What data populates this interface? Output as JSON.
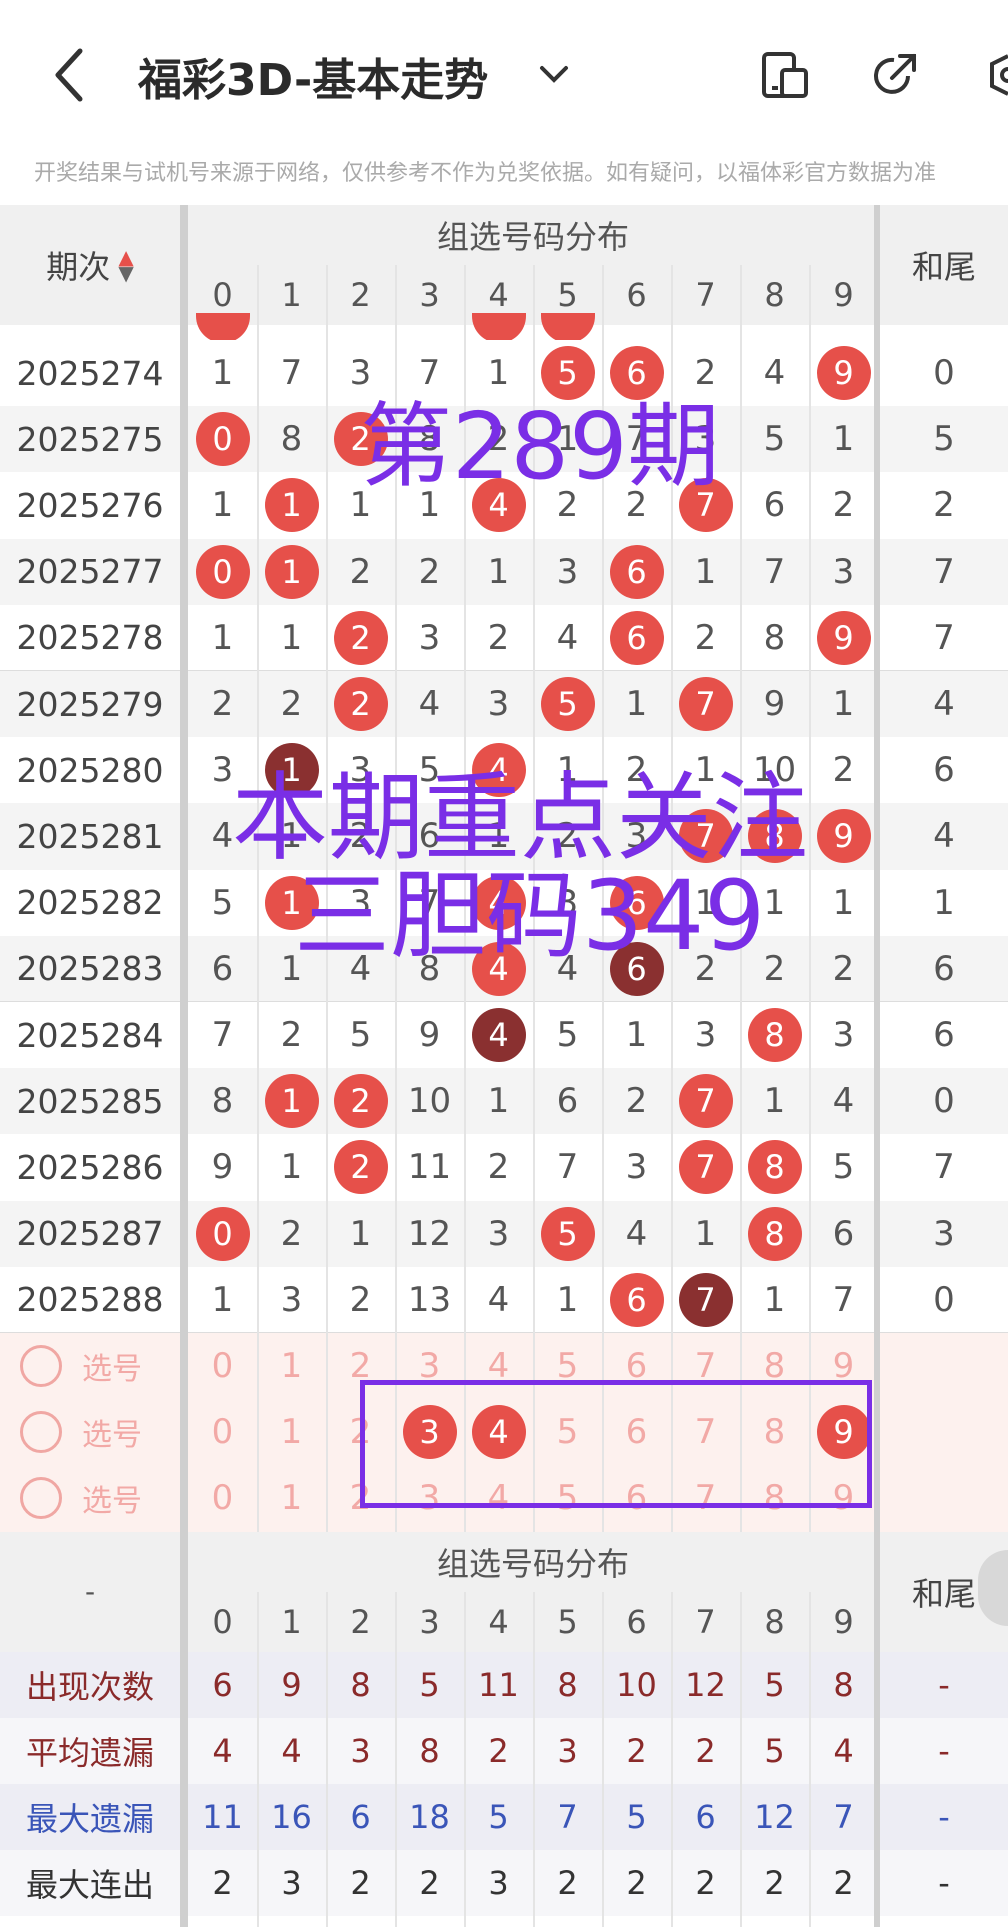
{
  "header": {
    "title": "福彩3D-基本走势",
    "notice": "开奖结果与试机号来源于网络，仅供参考不作为兑奖依据。如有疑问，以福体彩官方数据为准"
  },
  "table": {
    "col_period": "期次",
    "group_title": "组选号码分布",
    "digits": [
      "0",
      "1",
      "2",
      "3",
      "4",
      "5",
      "6",
      "7",
      "8",
      "9"
    ],
    "col_sum_tail": "和尾",
    "rows": [
      {
        "period": "2025274",
        "cells": [
          "1",
          "7",
          "3",
          "7",
          "1",
          "5",
          "6",
          "2",
          "4",
          "9"
        ],
        "hits": [
          5,
          6,
          9
        ],
        "dark": [],
        "tail": "0"
      },
      {
        "period": "2025275",
        "cells": [
          "0",
          "8",
          "2",
          "8",
          "2",
          "1",
          "7",
          "3",
          "5",
          "1"
        ],
        "hits": [
          0,
          2
        ],
        "dark": [],
        "tail": "5"
      },
      {
        "period": "2025276",
        "cells": [
          "1",
          "1",
          "1",
          "1",
          "4",
          "2",
          "2",
          "7",
          "6",
          "2"
        ],
        "hits": [
          1,
          4,
          7
        ],
        "dark": [],
        "tail": "2"
      },
      {
        "period": "2025277",
        "cells": [
          "0",
          "1",
          "2",
          "2",
          "1",
          "3",
          "6",
          "1",
          "7",
          "3"
        ],
        "hits": [
          0,
          1,
          6
        ],
        "dark": [],
        "tail": "7"
      },
      {
        "period": "2025278",
        "cells": [
          "1",
          "1",
          "2",
          "3",
          "2",
          "4",
          "6",
          "2",
          "8",
          "9"
        ],
        "hits": [
          2,
          6,
          9
        ],
        "dark": [],
        "tail": "7"
      },
      {
        "period": "2025279",
        "cells": [
          "2",
          "2",
          "2",
          "4",
          "3",
          "5",
          "1",
          "7",
          "9",
          "1"
        ],
        "hits": [
          2,
          5,
          7
        ],
        "dark": [],
        "tail": "4"
      },
      {
        "period": "2025280",
        "cells": [
          "3",
          "1",
          "3",
          "5",
          "4",
          "1",
          "2",
          "1",
          "10",
          "2"
        ],
        "hits": [
          4
        ],
        "dark": [
          1
        ],
        "tail": "6"
      },
      {
        "period": "2025281",
        "cells": [
          "4",
          "1",
          "2",
          "6",
          "1",
          "2",
          "3",
          "7",
          "8",
          "9"
        ],
        "hits": [
          7,
          8,
          9
        ],
        "dark": [],
        "tail": "4"
      },
      {
        "period": "2025282",
        "cells": [
          "5",
          "1",
          "3",
          "7",
          "4",
          "3",
          "6",
          "1",
          "1",
          "1"
        ],
        "hits": [
          1,
          4,
          6
        ],
        "dark": [],
        "tail": "1"
      },
      {
        "period": "2025283",
        "cells": [
          "6",
          "1",
          "4",
          "8",
          "4",
          "4",
          "6",
          "2",
          "2",
          "2"
        ],
        "hits": [
          4
        ],
        "dark": [
          6
        ],
        "tail": "6"
      },
      {
        "period": "2025284",
        "cells": [
          "7",
          "2",
          "5",
          "9",
          "4",
          "5",
          "1",
          "3",
          "8",
          "3"
        ],
        "hits": [
          8
        ],
        "dark": [
          4
        ],
        "tail": "6"
      },
      {
        "period": "2025285",
        "cells": [
          "8",
          "1",
          "2",
          "10",
          "1",
          "6",
          "2",
          "7",
          "1",
          "4"
        ],
        "hits": [
          1,
          2,
          7
        ],
        "dark": [],
        "tail": "0"
      },
      {
        "period": "2025286",
        "cells": [
          "9",
          "1",
          "2",
          "11",
          "2",
          "7",
          "3",
          "7",
          "8",
          "5"
        ],
        "hits": [
          2,
          7,
          8
        ],
        "dark": [],
        "tail": "7"
      },
      {
        "period": "2025287",
        "cells": [
          "0",
          "2",
          "1",
          "12",
          "3",
          "5",
          "4",
          "1",
          "8",
          "6"
        ],
        "hits": [
          0,
          5,
          8
        ],
        "dark": [],
        "tail": "3"
      },
      {
        "period": "2025288",
        "cells": [
          "1",
          "3",
          "2",
          "13",
          "4",
          "1",
          "6",
          "7",
          "1",
          "7"
        ],
        "hits": [
          6
        ],
        "dark": [
          7
        ],
        "tail": "0"
      }
    ],
    "select_label": "选号",
    "select_rows": [
      {
        "hits": []
      },
      {
        "hits": [
          3,
          4,
          9
        ]
      },
      {
        "hits": []
      }
    ],
    "footer_dash": "-",
    "stats": [
      {
        "label": "出现次数",
        "values": [
          "6",
          "9",
          "8",
          "5",
          "11",
          "8",
          "10",
          "12",
          "5",
          "8"
        ],
        "tail": "-",
        "color": "#8a2a2a"
      },
      {
        "label": "平均遗漏",
        "values": [
          "4",
          "4",
          "3",
          "8",
          "2",
          "3",
          "2",
          "2",
          "5",
          "4"
        ],
        "tail": "-",
        "color": "#8a2a2a"
      },
      {
        "label": "最大遗漏",
        "values": [
          "11",
          "16",
          "6",
          "18",
          "5",
          "7",
          "5",
          "6",
          "12",
          "7"
        ],
        "tail": "-",
        "color": "#3a55b8"
      },
      {
        "label": "最大连出",
        "values": [
          "2",
          "3",
          "2",
          "2",
          "3",
          "2",
          "2",
          "2",
          "2",
          "2"
        ],
        "tail": "-",
        "color": "#333333"
      }
    ]
  },
  "overlay": {
    "issue": "第289期",
    "focus_line1": "本期重点关注",
    "focus_line2": "三胆码349"
  },
  "colors": {
    "ball": "#e6504a",
    "ball_dark": "#8a3030",
    "overlay": "#7a2ee6"
  }
}
